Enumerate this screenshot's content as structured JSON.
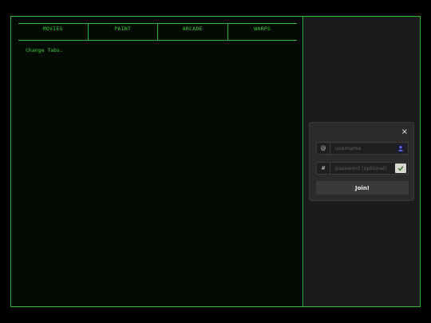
{
  "tabs": [
    {
      "label": "MOVIES"
    },
    {
      "label": "PAINT"
    },
    {
      "label": "ARCADE"
    },
    {
      "label": "WARPS"
    }
  ],
  "main": {
    "hint": "Change Tabs."
  },
  "join": {
    "close_label": "×",
    "username": {
      "prefix": "@",
      "placeholder": "username",
      "value": "",
      "icon": "user-avatar-icon"
    },
    "password": {
      "prefix": "#",
      "placeholder": "password (optional)",
      "value": "",
      "icon": "checkmark-icon"
    },
    "button_label": "Join!"
  },
  "colors": {
    "accent": "#2fb52f",
    "text_green": "#37d237",
    "panel_dark": "#1b1b1b",
    "card": "#2b2b2b"
  }
}
